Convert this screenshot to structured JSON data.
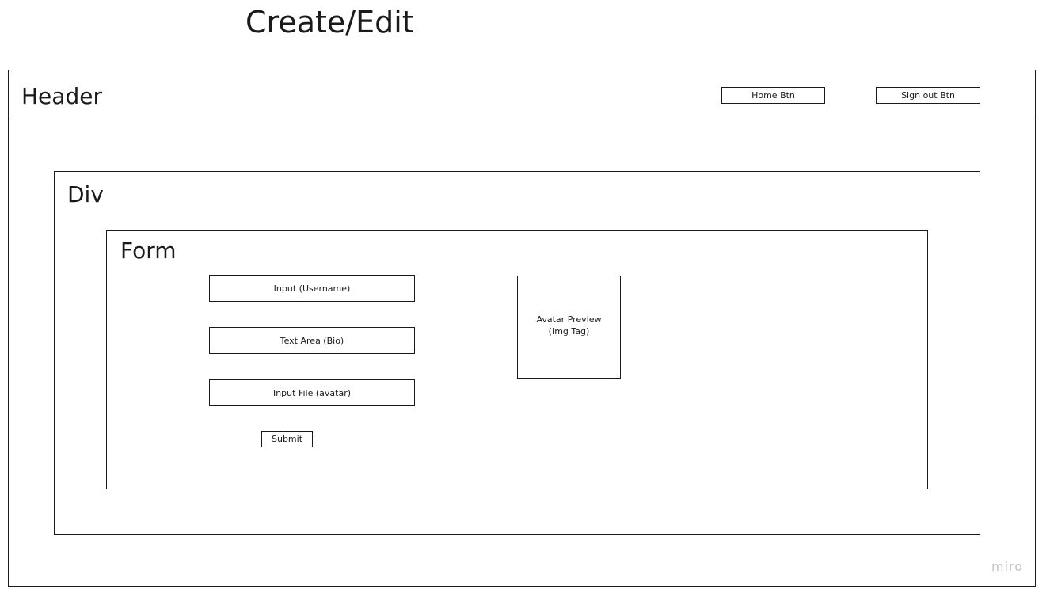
{
  "title": "Create/Edit",
  "header": {
    "label": "Header",
    "home_button": "Home Btn",
    "signout_button": "Sign out Btn"
  },
  "container": {
    "label": "Div"
  },
  "form": {
    "label": "Form",
    "fields": {
      "username": "Input (Username)",
      "bio": "Text Area (Bio)",
      "file": "Input File (avatar)"
    },
    "submit_label": "Submit",
    "avatar_preview": {
      "line1": "Avatar Preview",
      "line2": "(Img Tag)"
    }
  },
  "watermark": "miro"
}
